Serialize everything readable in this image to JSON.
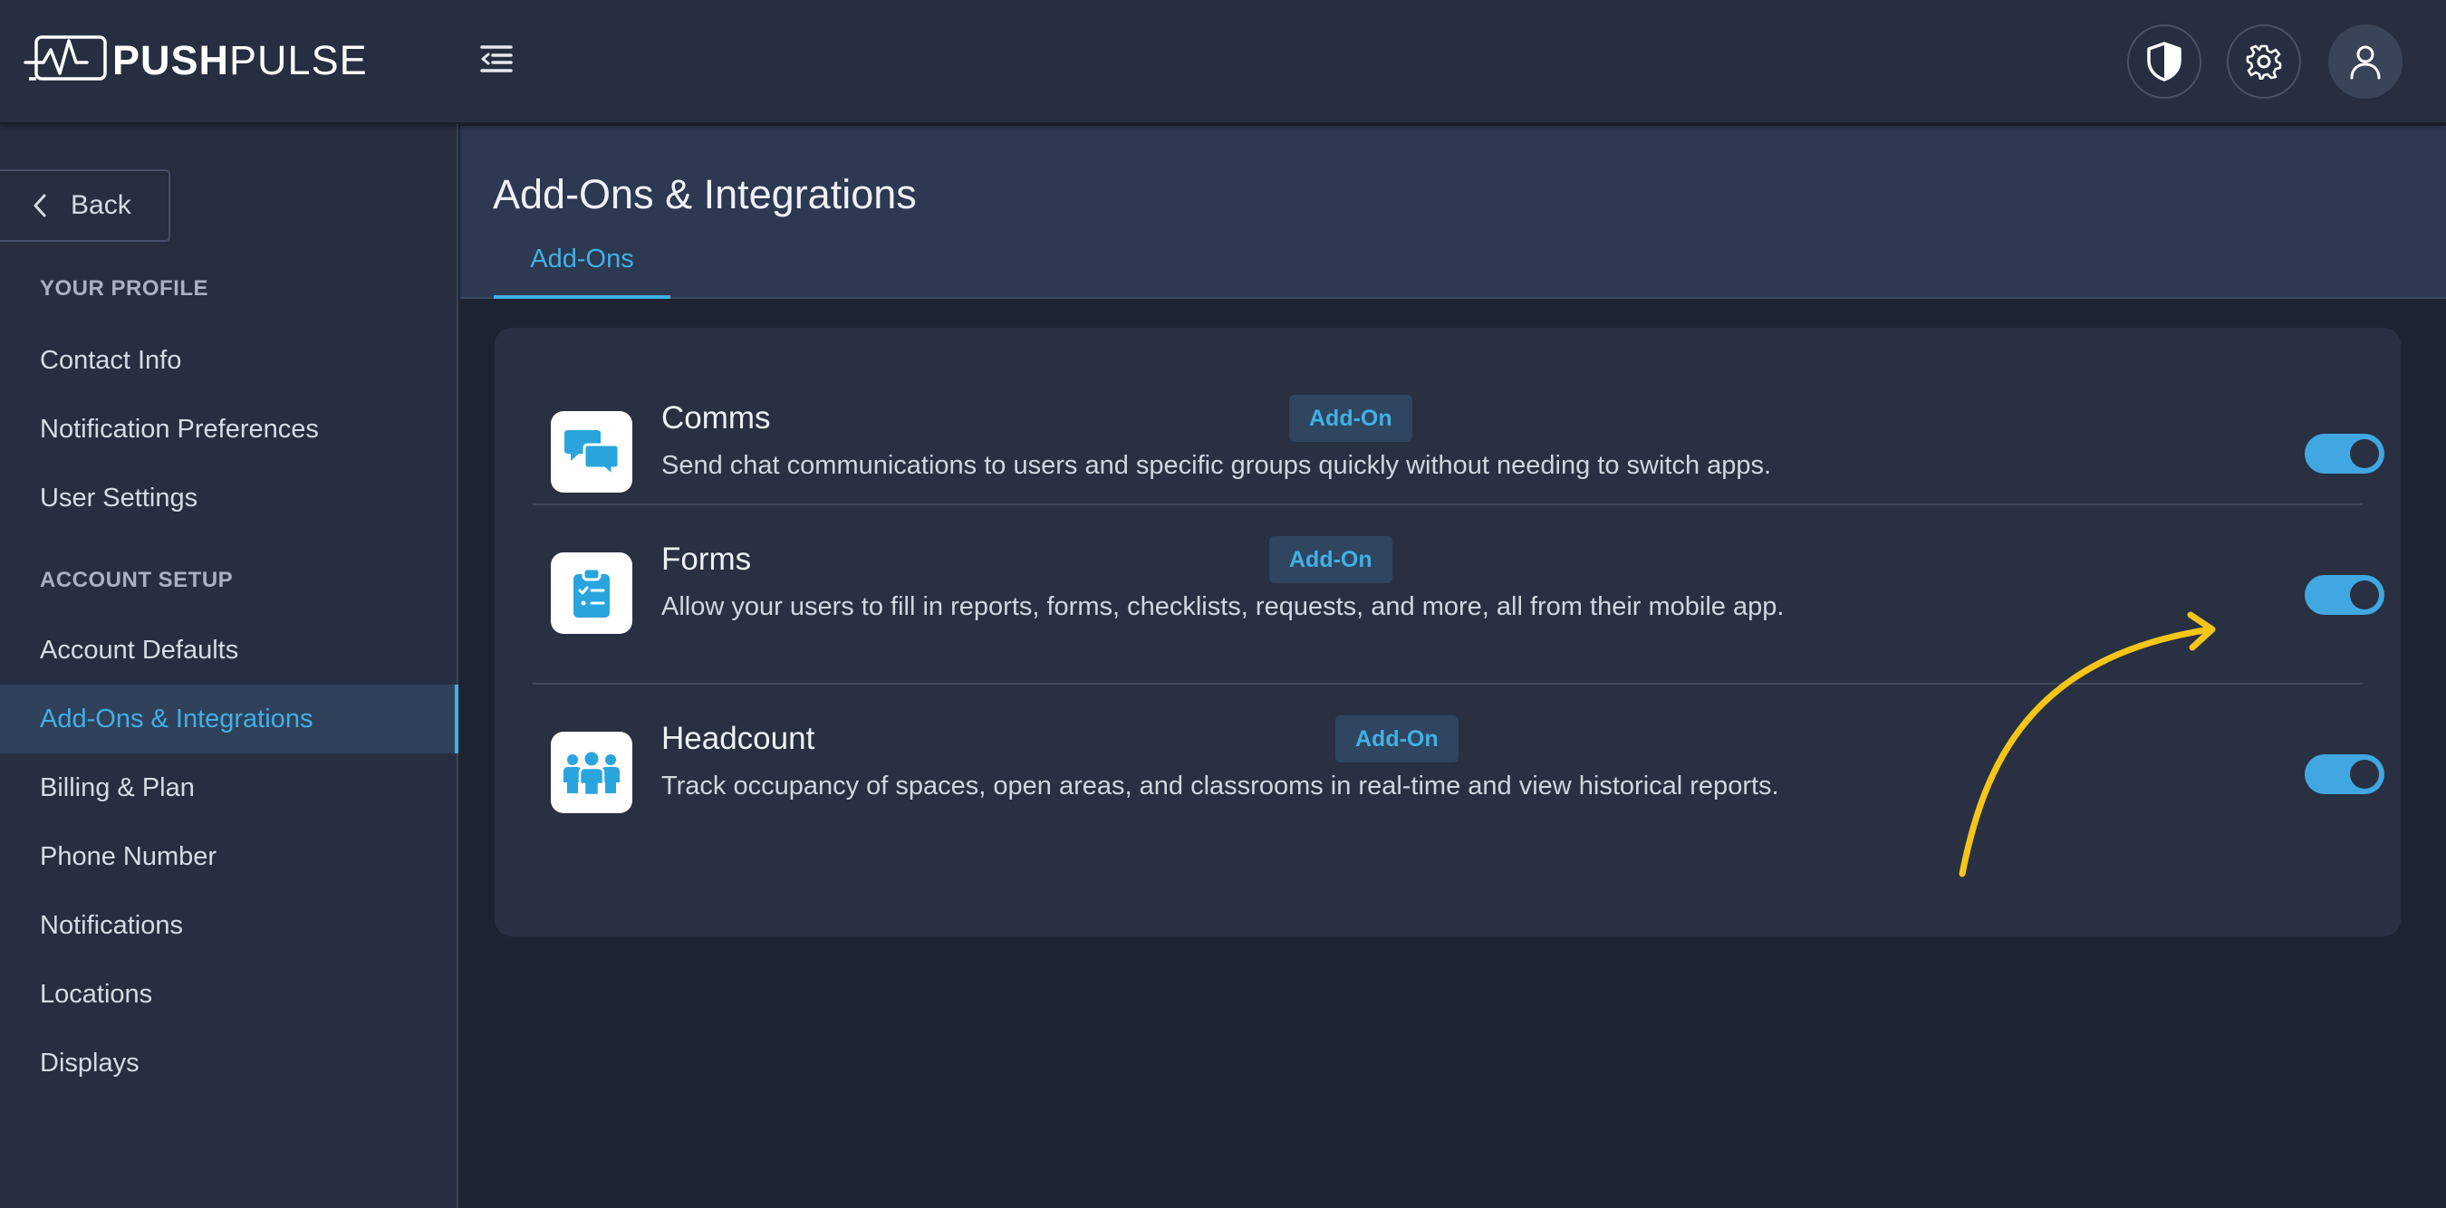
{
  "app": {
    "logo_bold": "PUSH",
    "logo_light": "PULSE"
  },
  "header": {
    "icons": [
      "menu-collapse-icon",
      "shield-icon",
      "gear-icon",
      "user-icon"
    ]
  },
  "sidebar": {
    "back_label": "Back",
    "profile_section": "YOUR PROFILE",
    "profile_items": [
      {
        "label": "Contact Info"
      },
      {
        "label": "Notification Preferences"
      },
      {
        "label": "User Settings"
      }
    ],
    "account_section": "ACCOUNT SETUP",
    "account_items": [
      {
        "label": "Account Defaults",
        "active": false
      },
      {
        "label": "Add-Ons & Integrations",
        "active": true
      },
      {
        "label": "Billing & Plan",
        "active": false
      },
      {
        "label": "Phone Number",
        "active": false
      },
      {
        "label": "Notifications",
        "active": false
      },
      {
        "label": "Locations",
        "active": false
      },
      {
        "label": "Displays",
        "active": false
      }
    ]
  },
  "main": {
    "title": "Add-Ons & Integrations",
    "tabs": [
      {
        "label": "Add-Ons",
        "active": true
      }
    ],
    "addons": [
      {
        "name": "Comms",
        "badge": "Add-On",
        "description": "Send chat communications to users and specific groups quickly without needing to switch apps.",
        "enabled": true,
        "icon": "chat-bubbles-icon"
      },
      {
        "name": "Forms",
        "badge": "Add-On",
        "description": "Allow your users to fill in reports, forms, checklists, requests, and more, all from their mobile app.",
        "enabled": true,
        "icon": "clipboard-checklist-icon"
      },
      {
        "name": "Headcount",
        "badge": "Add-On",
        "description": "Track occupancy of spaces, open areas, and classrooms in real-time and view historical reports.",
        "enabled": true,
        "icon": "people-group-icon"
      }
    ]
  },
  "colors": {
    "accent": "#41b0e4",
    "toggle_on": "#41a7e0",
    "annotation_arrow": "#f5c518"
  }
}
